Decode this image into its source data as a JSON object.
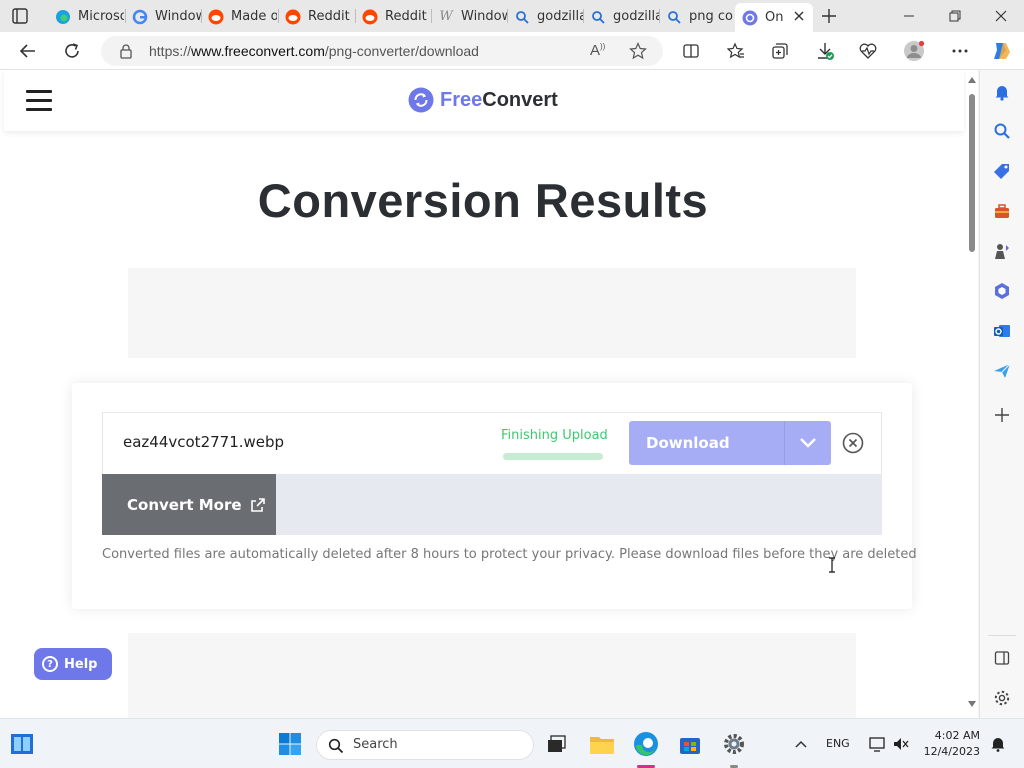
{
  "browser": {
    "tabs": [
      {
        "label": "Microsoft",
        "icon": "edge-icon"
      },
      {
        "label": "Windows",
        "icon": "google-icon"
      },
      {
        "label": "Made of",
        "icon": "reddit-icon"
      },
      {
        "label": "Reddit",
        "icon": "reddit-icon"
      },
      {
        "label": "Reddit",
        "icon": "reddit-icon"
      },
      {
        "label": "Windows",
        "icon": "wiki-icon"
      },
      {
        "label": "godzilla",
        "icon": "search-icon"
      },
      {
        "label": "godzilla",
        "icon": "search-icon"
      },
      {
        "label": "png co",
        "icon": "search-icon"
      },
      {
        "label": "On",
        "icon": "freeconvert-icon"
      }
    ],
    "address": {
      "prefix": "https://",
      "domain": "www.freeconvert.com",
      "path": "/png-converter/download"
    }
  },
  "site": {
    "logo_free": "Free",
    "logo_convert": "Convert",
    "page_title": "Conversion Results",
    "file": {
      "name": "eaz44vcot2771.webp",
      "status": "Finishing Upload",
      "progress": 1.0,
      "download_label": "Download"
    },
    "convert_more_label": "Convert More",
    "privacy_note": "Converted files are automatically deleted after 8 hours to protect your privacy. Please download files before they are deleted",
    "help_label": "Help"
  },
  "taskbar": {
    "search_label": "Search",
    "language": "ENG",
    "time": "4:02 AM",
    "date": "12/4/2023"
  },
  "colors": {
    "brand": "#6e78e8",
    "download_button": "#a6adf4",
    "status_green": "#3ec96f"
  }
}
